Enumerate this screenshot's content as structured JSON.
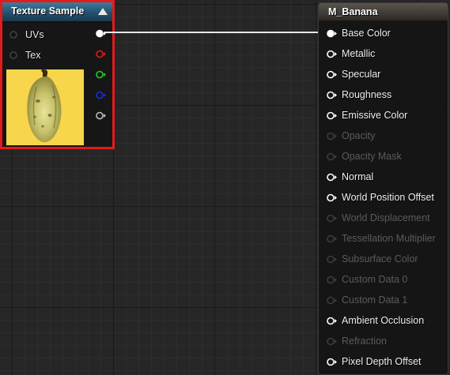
{
  "texture_node": {
    "title": "Texture Sample",
    "inputs": [
      {
        "label": "UVs"
      },
      {
        "label": "Tex"
      }
    ],
    "outputs": [
      {
        "channel": "RGB",
        "color": "#ffffff"
      },
      {
        "channel": "R",
        "color": "#e01a1a"
      },
      {
        "channel": "G",
        "color": "#1bd11b"
      },
      {
        "channel": "B",
        "color": "#1d2bd6"
      },
      {
        "channel": "A",
        "color": "#bdbdbd"
      }
    ],
    "preview_bg_color": "#f7d64b",
    "selection_border_color": "#e31b1b"
  },
  "material_node": {
    "title": "M_Banana",
    "inputs": [
      {
        "label": "Base Color",
        "enabled": true,
        "connected": true
      },
      {
        "label": "Metallic",
        "enabled": true,
        "connected": false
      },
      {
        "label": "Specular",
        "enabled": true,
        "connected": false
      },
      {
        "label": "Roughness",
        "enabled": true,
        "connected": false
      },
      {
        "label": "Emissive Color",
        "enabled": true,
        "connected": false
      },
      {
        "label": "Opacity",
        "enabled": false,
        "connected": false
      },
      {
        "label": "Opacity Mask",
        "enabled": false,
        "connected": false
      },
      {
        "label": "Normal",
        "enabled": true,
        "connected": false
      },
      {
        "label": "World Position Offset",
        "enabled": true,
        "connected": false
      },
      {
        "label": "World Displacement",
        "enabled": false,
        "connected": false
      },
      {
        "label": "Tessellation Multiplier",
        "enabled": false,
        "connected": false
      },
      {
        "label": "Subsurface Color",
        "enabled": false,
        "connected": false
      },
      {
        "label": "Custom Data 0",
        "enabled": false,
        "connected": false
      },
      {
        "label": "Custom Data 1",
        "enabled": false,
        "connected": false
      },
      {
        "label": "Ambient Occlusion",
        "enabled": true,
        "connected": false
      },
      {
        "label": "Refraction",
        "enabled": false,
        "connected": false
      },
      {
        "label": "Pixel Depth Offset",
        "enabled": true,
        "connected": false
      }
    ]
  },
  "wire": {
    "from": "Texture Sample RGB",
    "to": "Base Color",
    "color": "#e8e8e8"
  },
  "canvas": {
    "background_color": "#262626"
  }
}
